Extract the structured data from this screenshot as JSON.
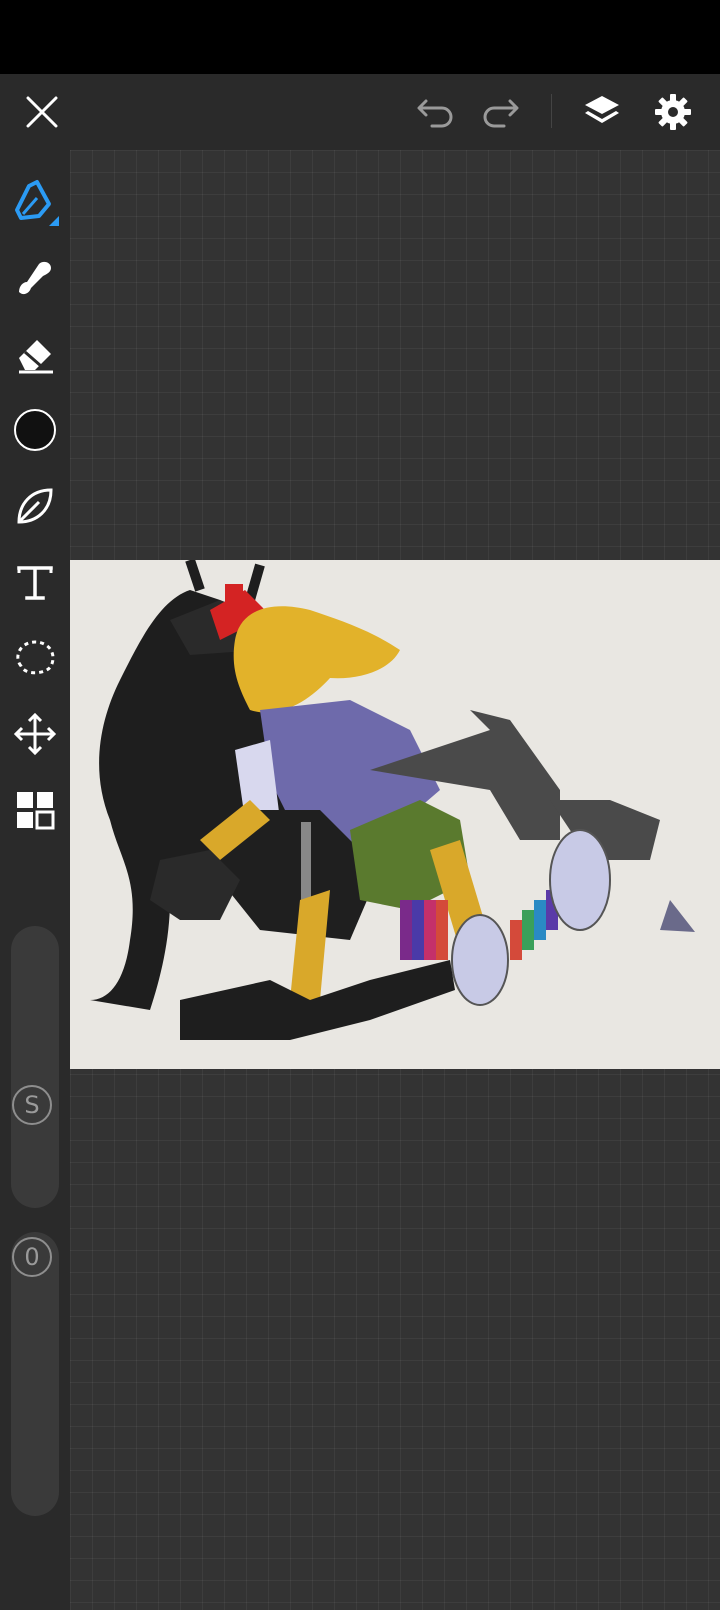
{
  "app": {
    "toolbar": {
      "close_icon": "close-icon",
      "undo_icon": "undo-icon",
      "redo_icon": "redo-icon",
      "layers_icon": "layers-icon",
      "settings_icon": "gear-icon"
    },
    "tools": [
      {
        "name": "pen",
        "icon": "pen-icon",
        "active": true
      },
      {
        "name": "smudge",
        "icon": "smudge-brush-icon"
      },
      {
        "name": "eraser",
        "icon": "eraser-icon"
      },
      {
        "name": "color",
        "icon": "color-swatch-icon",
        "color": "#111111"
      },
      {
        "name": "leaf-brush",
        "icon": "brush-leaf-icon"
      },
      {
        "name": "text",
        "icon": "text-icon"
      },
      {
        "name": "lasso",
        "icon": "lasso-select-icon"
      },
      {
        "name": "move",
        "icon": "move-arrows-icon"
      },
      {
        "name": "more",
        "icon": "grid-menu-icon"
      }
    ],
    "sliders": {
      "size_label": "S",
      "opacity_label": "0"
    },
    "colors": {
      "accent": "#2b9bf4",
      "chrome_bg": "#2a2a2a",
      "workspace_bg": "#333333",
      "canvas_paper": "#e9e7e2"
    }
  }
}
